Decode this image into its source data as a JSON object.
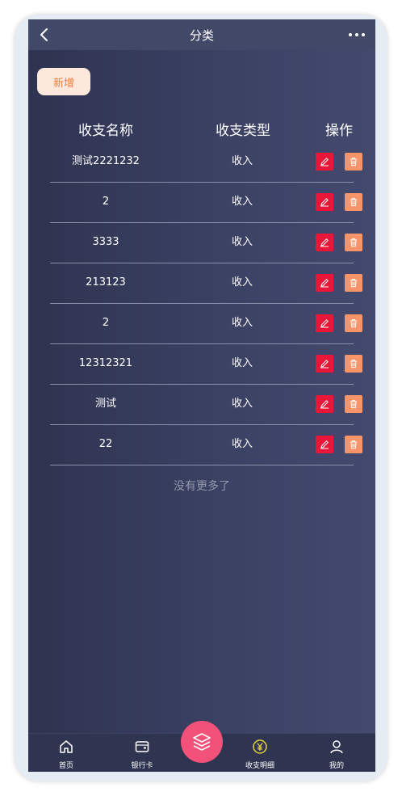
{
  "header": {
    "title": "分类"
  },
  "toolbar": {
    "add_label": "新增"
  },
  "table": {
    "columns": [
      "收支名称",
      "收支类型",
      "操作"
    ],
    "rows": [
      {
        "name": "测试2221232",
        "type": "收入"
      },
      {
        "name": "2",
        "type": "收入"
      },
      {
        "name": "3333",
        "type": "收入"
      },
      {
        "name": "213123",
        "type": "收入"
      },
      {
        "name": "2",
        "type": "收入"
      },
      {
        "name": "12312321",
        "type": "收入"
      },
      {
        "name": "测试",
        "type": "收入"
      },
      {
        "name": "22",
        "type": "收入"
      }
    ]
  },
  "footer_text": "没有更多了",
  "tabbar": {
    "items": [
      {
        "label": "首页",
        "icon": "home-icon"
      },
      {
        "label": "银行卡",
        "icon": "wallet-icon"
      },
      {
        "label": "收支明细",
        "icon": "yen-icon"
      },
      {
        "label": "我的",
        "icon": "user-icon"
      }
    ],
    "center_icon": "layers-icon"
  },
  "colors": {
    "edit_button": "#e8173a",
    "delete_button": "#f7946a",
    "add_button_bg": "#fde9dc",
    "add_button_text": "#f07d3b",
    "fab": "#f2517a",
    "yen_accent": "#e6d33a"
  }
}
